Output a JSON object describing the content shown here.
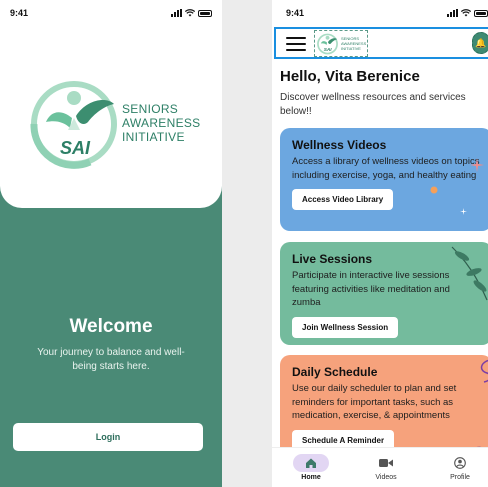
{
  "login_screen": {
    "status_time": "9:41",
    "logo_lines": [
      "SENIORS",
      "AWARENESS",
      "INITIATIVE"
    ],
    "logo_mark": "SAI",
    "welcome_title": "Welcome",
    "welcome_subtitle": "Your journey to balance and well-being starts here.",
    "login_label": "Login"
  },
  "home_screen": {
    "status_time": "9:41",
    "greeting": "Hello, Vita Berenice",
    "subtitle": "Discover wellness resources and services below!!",
    "cards": [
      {
        "title": "Wellness Videos",
        "description": "Access a library of wellness videos on topics including exercise, yoga, and healthy eating",
        "button": "Access Video Library",
        "color": "#6ca7e0"
      },
      {
        "title": "Live Sessions",
        "description": "Participate in interactive live sessions featuring activities like meditation and zumba",
        "button": "Join Wellness Session",
        "color": "#74bb9d"
      },
      {
        "title": "Daily Schedule",
        "description": "Use our daily scheduler to plan and set reminders for important tasks, such as medication, exercise, & appointments",
        "button": "Schedule A Reminder",
        "color": "#f6a27c"
      }
    ],
    "tabs": [
      {
        "label": "Home",
        "icon": "home-icon"
      },
      {
        "label": "Videos",
        "icon": "video-icon"
      },
      {
        "label": "Profile",
        "icon": "profile-icon"
      }
    ]
  },
  "colors": {
    "brand_green": "#4a8a76",
    "logo_green": "#2d7f66",
    "highlight_blue": "#1a8fe0"
  }
}
